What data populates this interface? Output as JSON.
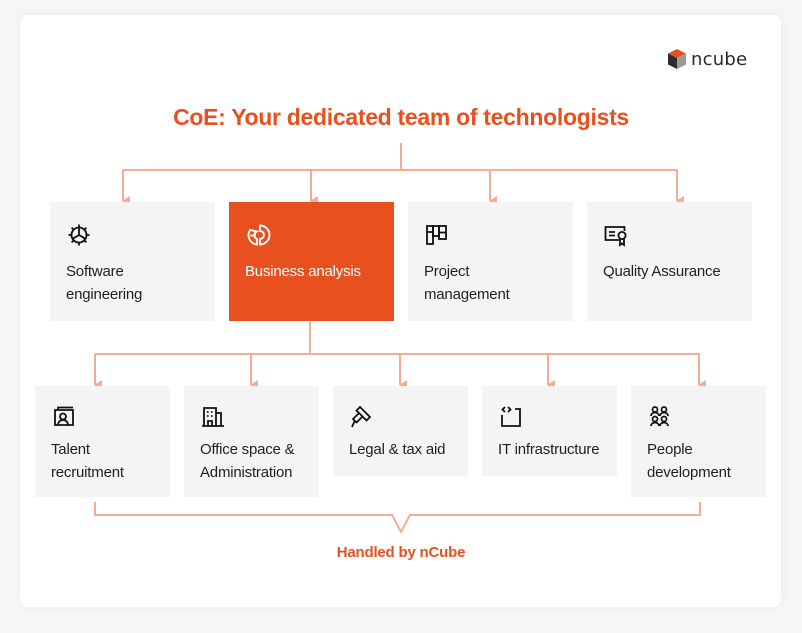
{
  "brand": {
    "logo_text": "ncube",
    "logo_icon": "cube-icon",
    "accent_color": "#e8501f",
    "connector_color": "#f3ad94"
  },
  "title": "CoE: Your dedicated team of technologists",
  "top_row": [
    {
      "label": "Software engineering",
      "icon": "gear-icon",
      "highlighted": false
    },
    {
      "label": "Business analysis",
      "icon": "pie-chart-icon",
      "highlighted": true
    },
    {
      "label": "Project management",
      "icon": "kanban-board-icon",
      "highlighted": false
    },
    {
      "label": "Quality Assurance",
      "icon": "certificate-icon",
      "highlighted": false
    }
  ],
  "bottom_row": [
    {
      "label": "Talent recruitment",
      "icon": "recruitment-icon"
    },
    {
      "label": "Office space & Administration",
      "icon": "office-building-icon"
    },
    {
      "label": "Legal & tax aid",
      "icon": "gavel-icon"
    },
    {
      "label": "IT infrastructure",
      "icon": "code-window-icon"
    },
    {
      "label": "People development",
      "icon": "people-group-icon"
    }
  ],
  "footer": "Handled by nCube"
}
